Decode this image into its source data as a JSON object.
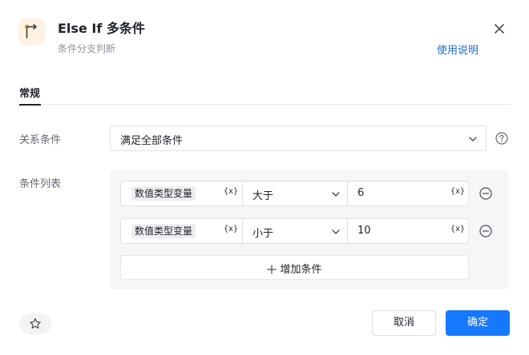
{
  "header": {
    "icon": "branch-icon",
    "title": "Else If 多条件",
    "subtitle": "条件分支判断",
    "help_link": "使用说明",
    "close_icon": "close-icon"
  },
  "tabs": [
    {
      "label": "常规",
      "active": true
    }
  ],
  "form": {
    "relation_label": "关系条件",
    "relation_value": "满足全部条件",
    "conditions_label": "条件列表",
    "conditions": [
      {
        "variable": "数值类型变量",
        "var_button": "{x}",
        "operator": "大于",
        "value": "6",
        "value_button": "{x}"
      },
      {
        "variable": "数值类型变量",
        "var_button": "{x}",
        "operator": "小于",
        "value": "10",
        "value_button": "{x}"
      }
    ],
    "add_label": "增加条件"
  },
  "footer": {
    "cancel_label": "取消",
    "ok_label": "确定"
  },
  "colors": {
    "primary": "#1677ff",
    "link": "#1f6fcc",
    "icon_bg": "#fdf3e3",
    "icon_accent": "#f08c00"
  }
}
